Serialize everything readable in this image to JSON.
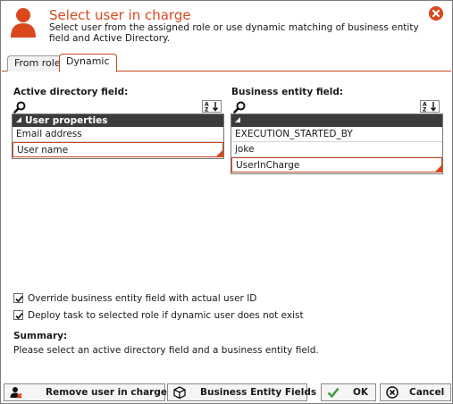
{
  "header": {
    "title": "Select user in charge",
    "subtitle": "Select user from the assigned role or use dynamic matching of business entity field and Active Directory."
  },
  "tabs": [
    {
      "label": "From role",
      "active": false
    },
    {
      "label": "Dynamic",
      "active": true
    }
  ],
  "active_directory": {
    "label": "Active directory field:",
    "group_header": "User properties",
    "items": [
      {
        "label": "Email address",
        "selected": false
      },
      {
        "label": "User name",
        "selected": true
      }
    ]
  },
  "business_entity": {
    "label": "Business entity field:",
    "group_header": "",
    "items": [
      {
        "label": "EXECUTION_STARTED_BY",
        "selected": false
      },
      {
        "label": "joke",
        "selected": false
      },
      {
        "label": "UserInCharge",
        "selected": true
      }
    ]
  },
  "options": {
    "override_label": "Override business entity field with actual user ID",
    "override_checked": true,
    "deploy_label": "Deploy task to selected role if dynamic user does not exist",
    "deploy_checked": true
  },
  "summary": {
    "title": "Summary:",
    "text": "Please select an active directory field and a business entity field."
  },
  "buttons": {
    "remove_label": "Remove user in charge",
    "entity_fields_label": "Business Entity Fields",
    "ok_label": "OK",
    "cancel_label": "Cancel"
  },
  "colors": {
    "accent": "#d9481c",
    "header_dark": "#3c3c3c",
    "ok_green": "#3a9a3a"
  },
  "icons": {
    "title": "user-icon",
    "close": "close-icon",
    "search": "search-icon",
    "sort": "sort-az-icon",
    "remove": "remove-user-icon",
    "entity": "cube-icon",
    "ok": "checkmark-icon",
    "cancel": "cancel-icon"
  }
}
